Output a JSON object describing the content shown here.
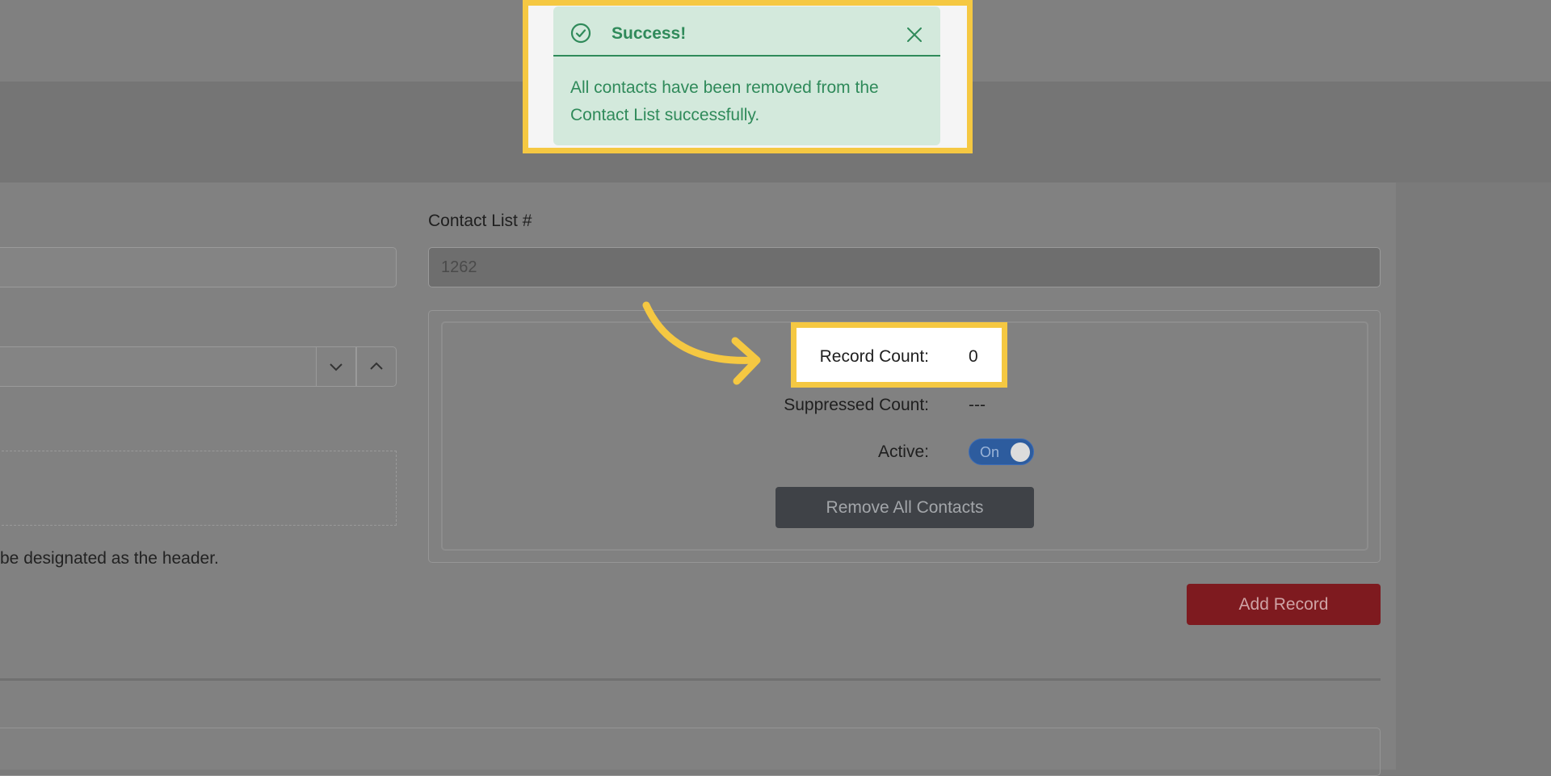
{
  "form": {
    "hint_text": "be designated as the header.",
    "contact_list_label": "Contact List #",
    "contact_list_value": "1262"
  },
  "stats": {
    "record_count_label": "Record Count:",
    "record_count_value": "0",
    "suppressed_count_label": "Suppressed Count:",
    "suppressed_count_value": "---",
    "active_label": "Active:",
    "active_toggle_text": "On"
  },
  "buttons": {
    "remove_all_contacts": "Remove All Contacts",
    "add_record": "Add Record"
  },
  "toast": {
    "title": "Success!",
    "message": "All contacts have been removed from the Contact List successfully.",
    "color": "#2f8a5a",
    "background": "#d3e9dc"
  },
  "highlight_color": "#f5c842"
}
